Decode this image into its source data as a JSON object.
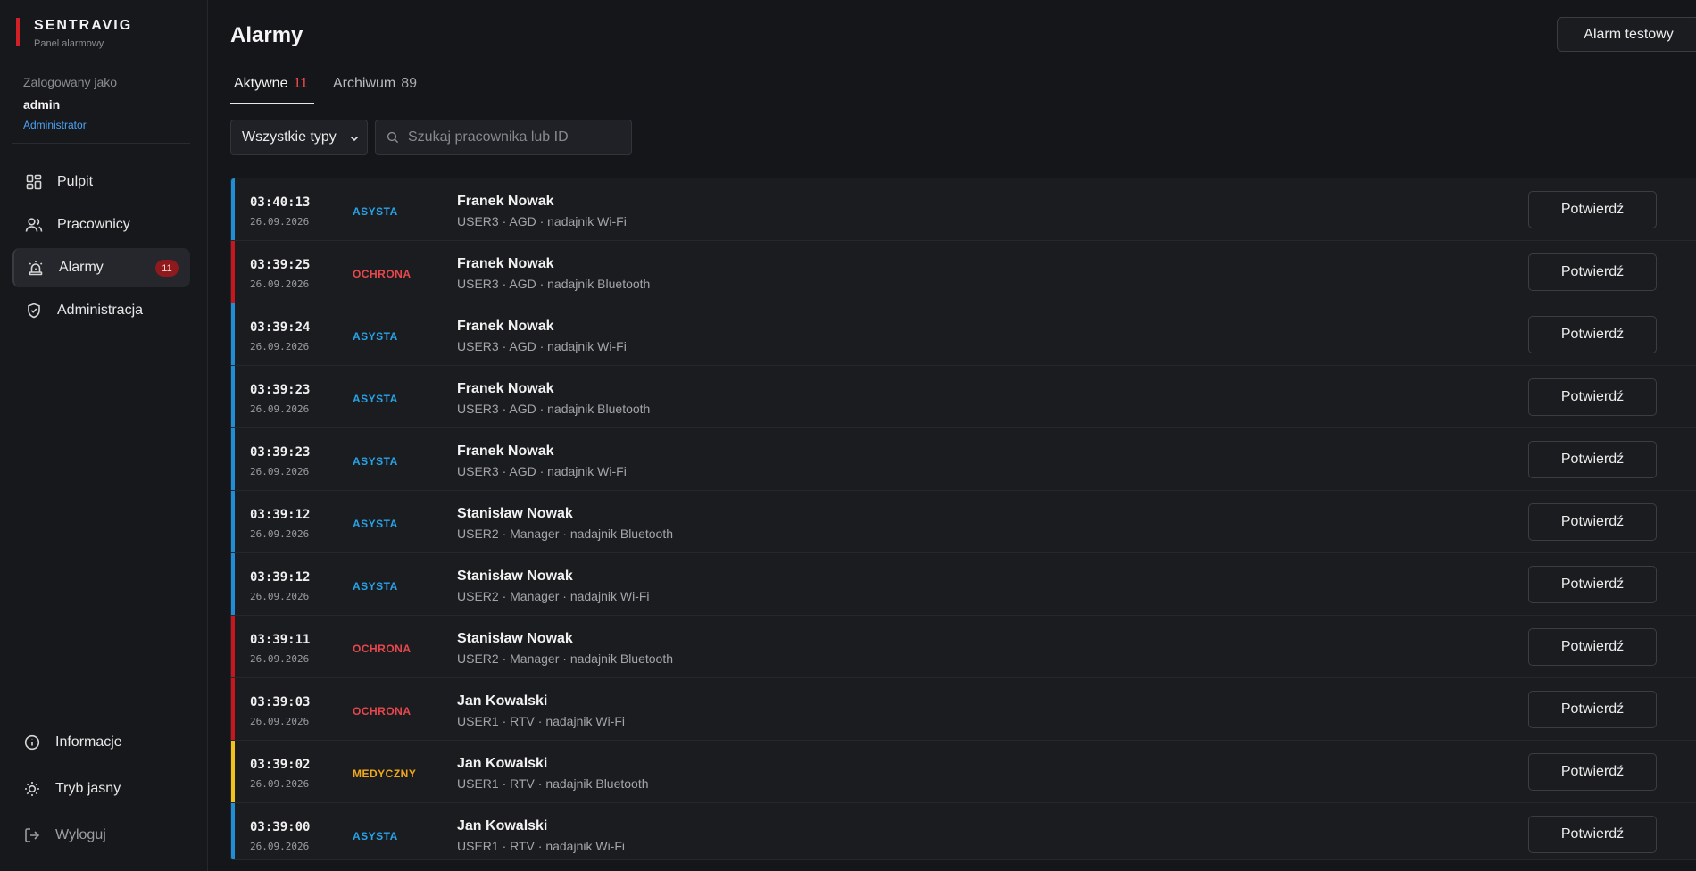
{
  "app": {
    "brand": "SENTRAVIG",
    "subtitle": "Panel alarmowy"
  },
  "user": {
    "label": "Zalogowany jako",
    "name": "admin",
    "role": "Administrator"
  },
  "nav": [
    {
      "label": "Pulpit",
      "icon": "dashboard-icon"
    },
    {
      "label": "Pracownicy",
      "icon": "users-icon"
    },
    {
      "label": "Alarmy",
      "icon": "siren-icon",
      "badge": "11",
      "active": true
    },
    {
      "label": "Administracja",
      "icon": "shield-icon"
    }
  ],
  "bottom_nav": [
    {
      "label": "Informacje",
      "icon": "info-icon"
    },
    {
      "label": "Tryb jasny",
      "icon": "sun-icon"
    },
    {
      "label": "Wyloguj",
      "icon": "logout-icon"
    }
  ],
  "header": {
    "title": "Alarmy",
    "test_button": "Alarm testowy"
  },
  "tabs": [
    {
      "label": "Aktywne",
      "count": "11"
    },
    {
      "label": "Archiwum",
      "count": "89"
    }
  ],
  "filters": {
    "type_selected": "Wszystkie typy",
    "search_placeholder": "Szukaj pracownika lub ID"
  },
  "colors": {
    "ASYSTA": "#27a3e8",
    "OCHRONA": "#e8484d",
    "MEDYCZNY": "#f0a91c",
    "bar_ASYSTA": "#1e8fd6",
    "bar_OCHRONA": "#c8161d",
    "bar_MEDYCZNY": "#f2c21b"
  },
  "confirm_label": "Potwierdź",
  "alarms": [
    {
      "time": "03:40:13",
      "date": "26.09.2026",
      "type": "ASYSTA",
      "name": "Franek Nowak",
      "meta": "USER3 · AGD · nadajnik Wi-Fi"
    },
    {
      "time": "03:39:25",
      "date": "26.09.2026",
      "type": "OCHRONA",
      "name": "Franek Nowak",
      "meta": "USER3 · AGD · nadajnik Bluetooth"
    },
    {
      "time": "03:39:24",
      "date": "26.09.2026",
      "type": "ASYSTA",
      "name": "Franek Nowak",
      "meta": "USER3 · AGD · nadajnik Wi-Fi"
    },
    {
      "time": "03:39:23",
      "date": "26.09.2026",
      "type": "ASYSTA",
      "name": "Franek Nowak",
      "meta": "USER3 · AGD · nadajnik Bluetooth"
    },
    {
      "time": "03:39:23",
      "date": "26.09.2026",
      "type": "ASYSTA",
      "name": "Franek Nowak",
      "meta": "USER3 · AGD · nadajnik Wi-Fi"
    },
    {
      "time": "03:39:12",
      "date": "26.09.2026",
      "type": "ASYSTA",
      "name": "Stanisław Nowak",
      "meta": "USER2 · Manager · nadajnik Bluetooth"
    },
    {
      "time": "03:39:12",
      "date": "26.09.2026",
      "type": "ASYSTA",
      "name": "Stanisław Nowak",
      "meta": "USER2 · Manager · nadajnik Wi-Fi"
    },
    {
      "time": "03:39:11",
      "date": "26.09.2026",
      "type": "OCHRONA",
      "name": "Stanisław Nowak",
      "meta": "USER2 · Manager · nadajnik Bluetooth"
    },
    {
      "time": "03:39:03",
      "date": "26.09.2026",
      "type": "OCHRONA",
      "name": "Jan Kowalski",
      "meta": "USER1 · RTV · nadajnik Wi-Fi"
    },
    {
      "time": "03:39:02",
      "date": "26.09.2026",
      "type": "MEDYCZNY",
      "name": "Jan Kowalski",
      "meta": "USER1 · RTV · nadajnik Bluetooth"
    },
    {
      "time": "03:39:00",
      "date": "26.09.2026",
      "type": "ASYSTA",
      "name": "Jan Kowalski",
      "meta": "USER1 · RTV · nadajnik Wi-Fi"
    }
  ]
}
